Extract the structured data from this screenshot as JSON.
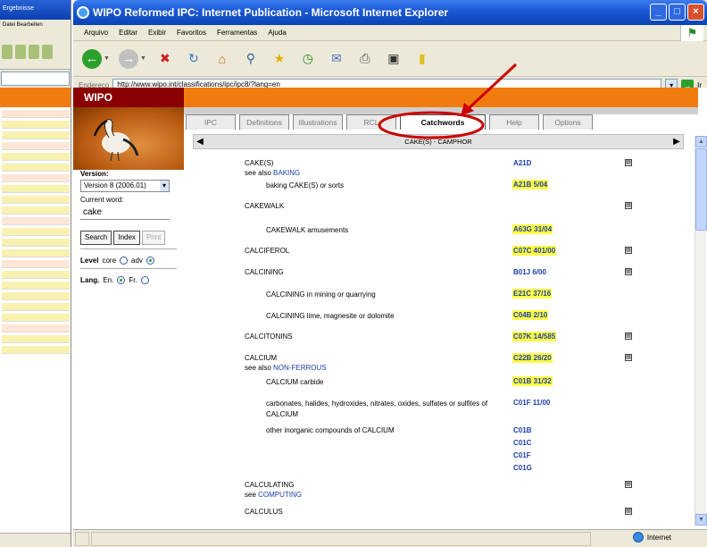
{
  "background_window": {
    "title": "Ergebnisse",
    "menu": "Datei Bearbeiten"
  },
  "browser": {
    "title": "WIPO Reformed IPC: Internet Publication - Microsoft Internet Explorer",
    "menu": [
      "Arquivo",
      "Editar",
      "Exibir",
      "Favoritos",
      "Ferramentas",
      "Ajuda"
    ],
    "address_label": "Endereço",
    "address_value": "http://www.wipo.int/classifications/ipc/ipc8/?lang=en",
    "go_label": "Ir",
    "status_zone": "Internet"
  },
  "page": {
    "logo_text": "WIPO",
    "sidebar": {
      "version_label": "Version:",
      "version_value": "Version 8 (2006.01)",
      "current_word_label": "Current word:",
      "current_word": "cake",
      "buttons": [
        "Search",
        "Index",
        "Print"
      ],
      "level_label": "Level",
      "level_options": [
        "core",
        "adv"
      ],
      "lang_label": "Lang.",
      "lang_options": [
        "En.",
        "Fr."
      ]
    },
    "tabs": [
      "IPC",
      "Definitions",
      "Illustrations",
      "RCL",
      "Catchwords",
      "Help",
      "Options"
    ],
    "active_tab": "Catchwords",
    "range_heading": "CAKE(S) - CAMPHOR",
    "entries": [
      {
        "term": "CAKE(S)",
        "code": "A21D",
        "hl": false,
        "icon": true,
        "see_prefix": "see also ",
        "see_link": "BAKING"
      },
      {
        "sub": "baking CAKE(S) or sorts",
        "code": "A21B 5/04",
        "hl": true
      },
      {
        "term": "CAKEWALK",
        "icon": true
      },
      {
        "sub": "CAKEWALK amusements",
        "code": "A63G 31/04",
        "hl": true
      },
      {
        "term": "CALCIFEROL",
        "code": "C07C 401/00",
        "hl": true,
        "icon": true
      },
      {
        "term": "CALCINING",
        "code": "B01J 6/00",
        "hl": false,
        "icon": true
      },
      {
        "sub": "CALCINING in mining or quarrying",
        "code": "E21C 37/16",
        "hl": true
      },
      {
        "sub": "CALCINING lime, magnesite or dolomite",
        "code": "C04B 2/10",
        "hl": true
      },
      {
        "term": "CALCITONINS",
        "code": "C07K 14/585",
        "hl": true,
        "icon": true
      },
      {
        "term": "CALCIUM",
        "code": "C22B 26/20",
        "hl": true,
        "icon": true,
        "see_prefix": "see also ",
        "see_link": "NON-FERROUS"
      },
      {
        "sub": "CALCIUM carbide",
        "code": "C01B 31/32",
        "hl": true
      },
      {
        "sub": "carbonates, halides, hydroxides, nitrates, oxides, sulfates or sulfites of CALCIUM",
        "code": "C01F 11/00",
        "hl": false
      },
      {
        "sub": "other inorganic compounds of CALCIUM",
        "codes": [
          "C01B",
          "C01C",
          "C01F",
          "C01G"
        ]
      },
      {
        "term": "CALCULATING",
        "icon": true,
        "see_prefix": "see ",
        "see_link": "COMPUTING"
      },
      {
        "term": "CALCULUS",
        "icon": true
      }
    ]
  },
  "colors": {
    "wipo_orange": "#f07c10",
    "wipo_dark_red": "#8a0000",
    "code_link": "#1a3ea8",
    "highlight": "#ffff44",
    "annotation_red": "#cc0000"
  },
  "icons": [
    "back-icon",
    "forward-icon",
    "stop-icon",
    "refresh-icon",
    "home-icon",
    "search-icon",
    "favorites-icon",
    "history-icon",
    "mail-icon",
    "print-icon",
    "edit-icon",
    "notes-icon",
    "windows-flag-icon",
    "go-icon",
    "globe-icon"
  ]
}
